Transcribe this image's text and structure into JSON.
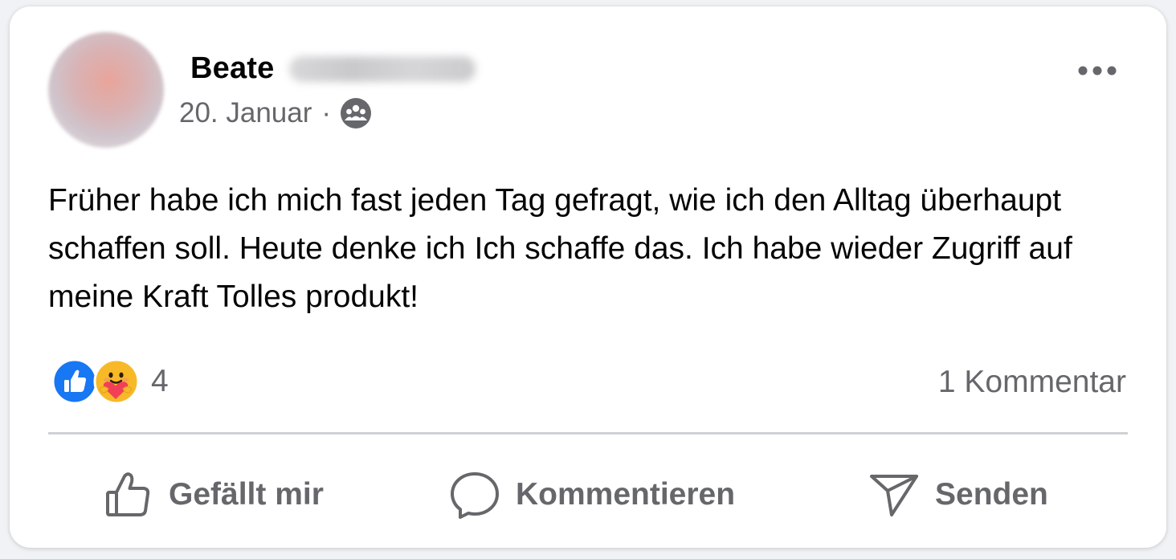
{
  "post": {
    "author_first_name": "Beate",
    "date": "20. Januar",
    "separator": "·",
    "audience_icon": "group-icon",
    "menu_icon": "more-icon",
    "text": "Früher habe ich mich fast jeden Tag gefragt, wie ich den Alltag überhaupt schaffen soll. Heute denke ich Ich schaffe das. Ich habe wieder Zugriff auf meine Kraft Tolles produkt!"
  },
  "reactions": {
    "types": [
      "like",
      "care"
    ],
    "count": "4",
    "comments_label": "1 Kommentar"
  },
  "actions": {
    "like_label": "Gefällt mir",
    "comment_label": "Kommentieren",
    "send_label": "Senden"
  },
  "colors": {
    "like_blue": "#1877f2",
    "care_yellow": "#f7b928",
    "heart_red": "#f33e58",
    "secondary_text": "#65676b",
    "primary_text": "#050505"
  }
}
